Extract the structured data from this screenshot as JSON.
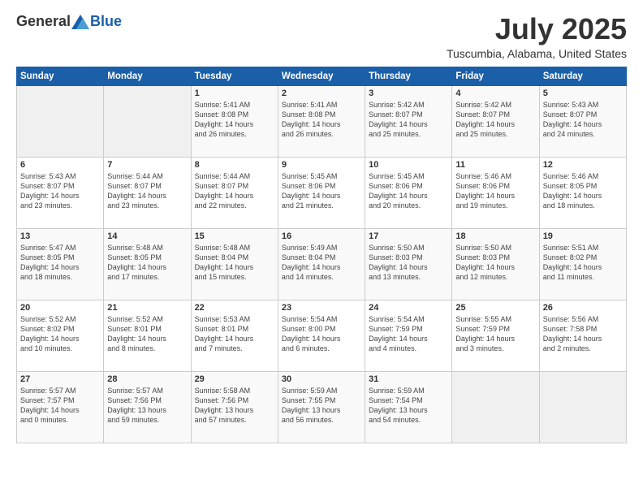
{
  "header": {
    "logo_general": "General",
    "logo_blue": "Blue",
    "title": "July 2025",
    "location": "Tuscumbia, Alabama, United States"
  },
  "days_header": [
    "Sunday",
    "Monday",
    "Tuesday",
    "Wednesday",
    "Thursday",
    "Friday",
    "Saturday"
  ],
  "weeks": [
    [
      {
        "day": "",
        "content": ""
      },
      {
        "day": "",
        "content": ""
      },
      {
        "day": "1",
        "content": "Sunrise: 5:41 AM\nSunset: 8:08 PM\nDaylight: 14 hours\nand 26 minutes."
      },
      {
        "day": "2",
        "content": "Sunrise: 5:41 AM\nSunset: 8:08 PM\nDaylight: 14 hours\nand 26 minutes."
      },
      {
        "day": "3",
        "content": "Sunrise: 5:42 AM\nSunset: 8:07 PM\nDaylight: 14 hours\nand 25 minutes."
      },
      {
        "day": "4",
        "content": "Sunrise: 5:42 AM\nSunset: 8:07 PM\nDaylight: 14 hours\nand 25 minutes."
      },
      {
        "day": "5",
        "content": "Sunrise: 5:43 AM\nSunset: 8:07 PM\nDaylight: 14 hours\nand 24 minutes."
      }
    ],
    [
      {
        "day": "6",
        "content": "Sunrise: 5:43 AM\nSunset: 8:07 PM\nDaylight: 14 hours\nand 23 minutes."
      },
      {
        "day": "7",
        "content": "Sunrise: 5:44 AM\nSunset: 8:07 PM\nDaylight: 14 hours\nand 23 minutes."
      },
      {
        "day": "8",
        "content": "Sunrise: 5:44 AM\nSunset: 8:07 PM\nDaylight: 14 hours\nand 22 minutes."
      },
      {
        "day": "9",
        "content": "Sunrise: 5:45 AM\nSunset: 8:06 PM\nDaylight: 14 hours\nand 21 minutes."
      },
      {
        "day": "10",
        "content": "Sunrise: 5:45 AM\nSunset: 8:06 PM\nDaylight: 14 hours\nand 20 minutes."
      },
      {
        "day": "11",
        "content": "Sunrise: 5:46 AM\nSunset: 8:06 PM\nDaylight: 14 hours\nand 19 minutes."
      },
      {
        "day": "12",
        "content": "Sunrise: 5:46 AM\nSunset: 8:05 PM\nDaylight: 14 hours\nand 18 minutes."
      }
    ],
    [
      {
        "day": "13",
        "content": "Sunrise: 5:47 AM\nSunset: 8:05 PM\nDaylight: 14 hours\nand 18 minutes."
      },
      {
        "day": "14",
        "content": "Sunrise: 5:48 AM\nSunset: 8:05 PM\nDaylight: 14 hours\nand 17 minutes."
      },
      {
        "day": "15",
        "content": "Sunrise: 5:48 AM\nSunset: 8:04 PM\nDaylight: 14 hours\nand 15 minutes."
      },
      {
        "day": "16",
        "content": "Sunrise: 5:49 AM\nSunset: 8:04 PM\nDaylight: 14 hours\nand 14 minutes."
      },
      {
        "day": "17",
        "content": "Sunrise: 5:50 AM\nSunset: 8:03 PM\nDaylight: 14 hours\nand 13 minutes."
      },
      {
        "day": "18",
        "content": "Sunrise: 5:50 AM\nSunset: 8:03 PM\nDaylight: 14 hours\nand 12 minutes."
      },
      {
        "day": "19",
        "content": "Sunrise: 5:51 AM\nSunset: 8:02 PM\nDaylight: 14 hours\nand 11 minutes."
      }
    ],
    [
      {
        "day": "20",
        "content": "Sunrise: 5:52 AM\nSunset: 8:02 PM\nDaylight: 14 hours\nand 10 minutes."
      },
      {
        "day": "21",
        "content": "Sunrise: 5:52 AM\nSunset: 8:01 PM\nDaylight: 14 hours\nand 8 minutes."
      },
      {
        "day": "22",
        "content": "Sunrise: 5:53 AM\nSunset: 8:01 PM\nDaylight: 14 hours\nand 7 minutes."
      },
      {
        "day": "23",
        "content": "Sunrise: 5:54 AM\nSunset: 8:00 PM\nDaylight: 14 hours\nand 6 minutes."
      },
      {
        "day": "24",
        "content": "Sunrise: 5:54 AM\nSunset: 7:59 PM\nDaylight: 14 hours\nand 4 minutes."
      },
      {
        "day": "25",
        "content": "Sunrise: 5:55 AM\nSunset: 7:59 PM\nDaylight: 14 hours\nand 3 minutes."
      },
      {
        "day": "26",
        "content": "Sunrise: 5:56 AM\nSunset: 7:58 PM\nDaylight: 14 hours\nand 2 minutes."
      }
    ],
    [
      {
        "day": "27",
        "content": "Sunrise: 5:57 AM\nSunset: 7:57 PM\nDaylight: 14 hours\nand 0 minutes."
      },
      {
        "day": "28",
        "content": "Sunrise: 5:57 AM\nSunset: 7:56 PM\nDaylight: 13 hours\nand 59 minutes."
      },
      {
        "day": "29",
        "content": "Sunrise: 5:58 AM\nSunset: 7:56 PM\nDaylight: 13 hours\nand 57 minutes."
      },
      {
        "day": "30",
        "content": "Sunrise: 5:59 AM\nSunset: 7:55 PM\nDaylight: 13 hours\nand 56 minutes."
      },
      {
        "day": "31",
        "content": "Sunrise: 5:59 AM\nSunset: 7:54 PM\nDaylight: 13 hours\nand 54 minutes."
      },
      {
        "day": "",
        "content": ""
      },
      {
        "day": "",
        "content": ""
      }
    ]
  ]
}
